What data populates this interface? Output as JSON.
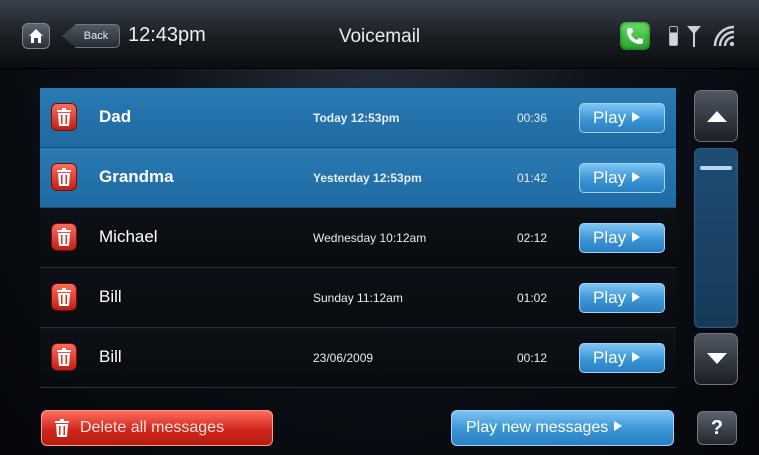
{
  "header": {
    "back_label": "Back",
    "time": "12:43pm",
    "title": "Voicemail"
  },
  "status_icons": [
    "home-icon",
    "phone-icon",
    "battery-icon",
    "signal-icon",
    "wifi-icon"
  ],
  "messages": [
    {
      "name": "Dad",
      "date": "Today 12:53pm",
      "duration": "00:36",
      "play_label": "Play",
      "selected": true
    },
    {
      "name": "Grandma",
      "date": "Yesterday 12:53pm",
      "duration": "01:42",
      "play_label": "Play",
      "selected": true
    },
    {
      "name": "Michael",
      "date": "Wednesday 10:12am",
      "duration": "02:12",
      "play_label": "Play",
      "selected": false
    },
    {
      "name": "Bill",
      "date": "Sunday 11:12am",
      "duration": "01:02",
      "play_label": "Play",
      "selected": false
    },
    {
      "name": "Bill",
      "date": "23/06/2009",
      "duration": "00:12",
      "play_label": "Play",
      "selected": false
    }
  ],
  "footer": {
    "delete_all_label": "Delete all messages",
    "play_new_label": "Play new messages",
    "help_label": "?"
  },
  "colors": {
    "selected_row": "#2373ab",
    "play_button": "#3a95d6",
    "delete_button": "#d0271c",
    "call_icon": "#2fb534"
  }
}
